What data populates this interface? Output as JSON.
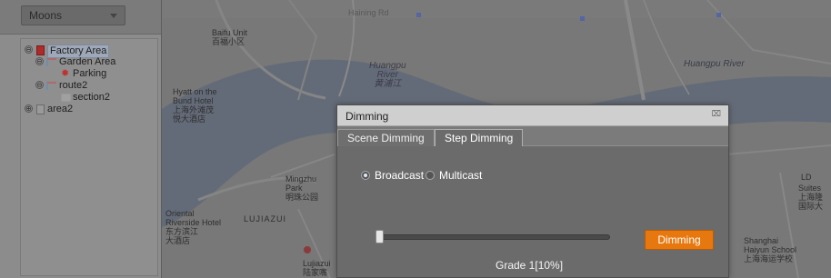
{
  "sidebar": {
    "layer_select": "Moons",
    "tree": [
      {
        "label": "Factory Area",
        "toggle": "⊖"
      },
      {
        "label": "Garden Area",
        "toggle": "⊖"
      },
      {
        "label": "Parking"
      },
      {
        "label": "route2",
        "toggle": "⊖"
      },
      {
        "label": "section2"
      },
      {
        "label": "area2",
        "toggle": "⊕"
      }
    ]
  },
  "map": {
    "labels": {
      "baifu": "Baifu Unit",
      "baifu_cn": "百福小区",
      "huangpu_river_1": "Huangpu",
      "huangpu_river_2": "River",
      "huangpu_river_cn": "黄浦江",
      "huangpu_river_east": "Huangpu River",
      "hyatt_1": "Hyatt on the",
      "hyatt_2": "Bund Hotel",
      "hyatt_cn_1": "上海外滩茂",
      "hyatt_cn_2": "悦大酒店",
      "mingzhu_1": "Mingzhu",
      "mingzhu_2": "Park",
      "mingzhu_cn": "明珠公园",
      "oriental_1": "Oriental",
      "oriental_2": "Riverside Hotel",
      "oriental_cn_1": "东方滨江",
      "oriental_cn_2": "大酒店",
      "lujiazui_caps": "LUJIAZUI",
      "lujiazui": "Lujiazui",
      "lujiazui_cn": "陆家嘴",
      "haining": "Haining Rd",
      "shanghai_1": "Shanghai",
      "shanghai_2": "Haiyun School",
      "shanghai_cn": "上海海运学校",
      "suites_1": "Suites",
      "suites_cn_1": "上海隆",
      "suites_cn_2": "国际大",
      "ld": "LD"
    }
  },
  "dialog": {
    "title": "Dimming",
    "close_glyph": "⌧",
    "tabs": [
      "Scene Dimming",
      "Step Dimming"
    ],
    "active_tab": "Step Dimming",
    "mode_options": [
      "Broadcast",
      "Multicast"
    ],
    "selected_mode": "Broadcast",
    "slider_level": 0.1,
    "grade_text": "Grade 1[10%]",
    "button_label": "Dimming"
  },
  "colors": {
    "accent_button": "#e7780f",
    "dialog_bg": "#6b6b6b",
    "title_bar": "#cfcfcf"
  }
}
